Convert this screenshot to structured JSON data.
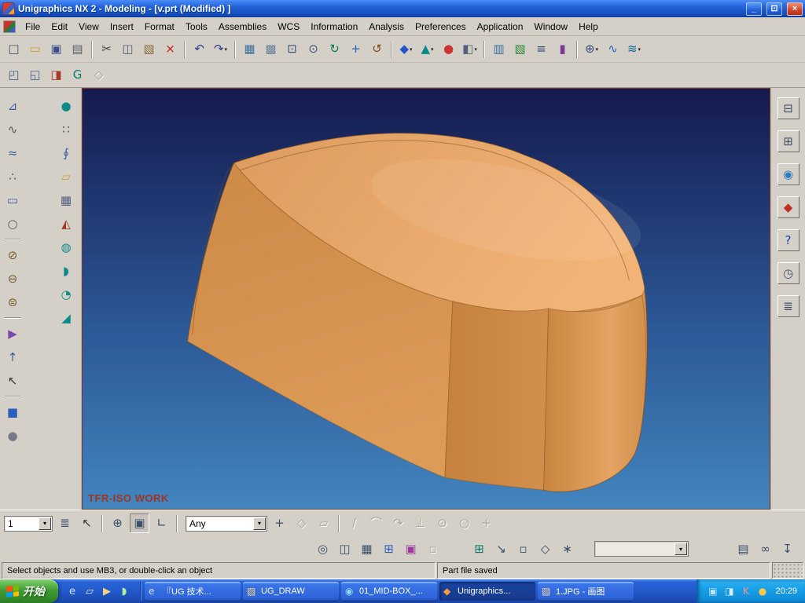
{
  "ui": {
    "dropdown_glyph": "▾"
  },
  "window": {
    "title": "Unigraphics NX 2 - Modeling - [v.prt (Modified) ]",
    "controls": [
      {
        "name": "minimize-button",
        "glyph": "_"
      },
      {
        "name": "restore-button",
        "glyph": "⊡"
      },
      {
        "name": "close-button",
        "glyph": "×"
      }
    ]
  },
  "menu": {
    "items": [
      "File",
      "Edit",
      "View",
      "Insert",
      "Format",
      "Tools",
      "Assemblies",
      "WCS",
      "Information",
      "Analysis",
      "Preferences",
      "Application",
      "Window",
      "Help"
    ]
  },
  "toolbar_main": [
    {
      "name": "new-icon",
      "glyph": "□",
      "color": "#44506a"
    },
    {
      "name": "open-icon",
      "glyph": "▭",
      "color": "#caa12c"
    },
    {
      "name": "save-icon",
      "glyph": "▣",
      "color": "#3a4f8c"
    },
    {
      "name": "print-icon",
      "glyph": "▤",
      "color": "#5a5f66"
    },
    {
      "sep": true
    },
    {
      "name": "cut-icon",
      "glyph": "✂",
      "color": "#444444"
    },
    {
      "name": "copy-icon",
      "glyph": "◫",
      "color": "#55607a"
    },
    {
      "name": "paste-icon",
      "glyph": "▧",
      "color": "#8a6a3a"
    },
    {
      "name": "delete-icon",
      "glyph": "×",
      "color": "#c41a1a"
    },
    {
      "sep": true
    },
    {
      "name": "undo-icon",
      "glyph": "↶",
      "color": "#2a3f8c"
    },
    {
      "name": "redo-icon",
      "glyph": "↷",
      "color": "#2a3f8c",
      "dropdown": true
    },
    {
      "sep": true
    },
    {
      "name": "object-display-icon",
      "glyph": "▦",
      "color": "#3a6f9c"
    },
    {
      "name": "display-mode-icon",
      "glyph": "▩",
      "color": "#6a7f9c"
    },
    {
      "name": "fit-view-icon",
      "glyph": "⊡",
      "color": "#3a4f7c"
    },
    {
      "name": "zoom-icon",
      "glyph": "⊙",
      "color": "#3a4f7c"
    },
    {
      "name": "refresh-icon",
      "glyph": "↻",
      "color": "#0a7a5a"
    },
    {
      "name": "pan-icon",
      "glyph": "+",
      "color": "#2a5fbc"
    },
    {
      "name": "rotate-view-icon",
      "glyph": "↺",
      "color": "#7a4a1a"
    },
    {
      "sep": true
    },
    {
      "name": "shaded-view-icon",
      "glyph": "◆",
      "color": "#2255cc",
      "dropdown": true
    },
    {
      "name": "wireframe-view-icon",
      "glyph": "▲",
      "color": "#0a8a8a",
      "dropdown": true
    },
    {
      "name": "orient-view-icon",
      "glyph": "●",
      "color": "#cc3333"
    },
    {
      "name": "iso-view-icon",
      "glyph": "◧",
      "color": "#55607a",
      "dropdown": true
    },
    {
      "sep": true
    },
    {
      "name": "drafting-icon",
      "glyph": "▥",
      "color": "#3a6f9c"
    },
    {
      "name": "sketch-task-icon",
      "glyph": "▧",
      "color": "#2a8a3a"
    },
    {
      "name": "layer-settings-icon",
      "glyph": "≡",
      "color": "#3a4f6c"
    },
    {
      "name": "expressions-icon",
      "glyph": "▮",
      "color": "#7a3a9c"
    },
    {
      "sep": true
    },
    {
      "name": "snap-point-icon",
      "glyph": "⊕",
      "color": "#3a4f7c",
      "dropdown": true
    },
    {
      "name": "curve-analysis-icon",
      "glyph": "∿",
      "color": "#2a5fbc"
    },
    {
      "name": "visualization-icon",
      "glyph": "≋",
      "color": "#0a6a9a",
      "dropdown": true
    }
  ],
  "toolbar_feature": [
    {
      "name": "pattern-feature-icon",
      "glyph": "◰",
      "color": "#45608a"
    },
    {
      "name": "extrude-feature-icon",
      "glyph": "◱",
      "color": "#45608a"
    },
    {
      "name": "instance-feature-icon",
      "glyph": "◨",
      "color": "#a33a2a"
    },
    {
      "name": "group-feature-icon",
      "glyph": "G",
      "color": "#0a7a6a"
    },
    {
      "name": "update-feature-icon",
      "glyph": "◇",
      "color": "#999999",
      "disabled": true
    }
  ],
  "left_col1": [
    {
      "name": "sketch-icon",
      "glyph": "⊿",
      "color": "#3a5f9c"
    },
    {
      "name": "dashed-curve-icon",
      "glyph": "∿",
      "color": "#555555"
    },
    {
      "name": "spline-icon",
      "glyph": "≈",
      "color": "#3a5f9c"
    },
    {
      "name": "point-icon",
      "glyph": "∴",
      "color": "#555555"
    },
    {
      "name": "rectangle-icon",
      "glyph": "▭",
      "color": "#3a5f9c"
    },
    {
      "name": "ellipse-icon",
      "glyph": "○",
      "color": "#555555"
    },
    {
      "sep": true
    },
    {
      "name": "trim-icon",
      "glyph": "⊘",
      "color": "#7a5a2a"
    },
    {
      "name": "extend-icon",
      "glyph": "⊖",
      "color": "#7a5a2a"
    },
    {
      "name": "offset-icon",
      "glyph": "⊜",
      "color": "#7a5a2a"
    },
    {
      "sep": true
    },
    {
      "name": "project-curve-icon",
      "glyph": "▶",
      "color": "#7a4aaa"
    },
    {
      "name": "raise-icon",
      "glyph": "↑",
      "color": "#3a5f9c"
    },
    {
      "name": "select-arrow-icon",
      "glyph": "↖",
      "color": "#333333"
    },
    {
      "sep": true
    },
    {
      "name": "block-blue-icon",
      "glyph": "■",
      "color": "#2a5fbc"
    },
    {
      "name": "cylinder-gray-icon",
      "glyph": "●",
      "color": "#777788"
    }
  ],
  "left_col2": [
    {
      "name": "sphere-teal-icon",
      "glyph": "●",
      "color": "#0f8a8a"
    },
    {
      "name": "point-set-icon",
      "glyph": "∷",
      "color": "#555555"
    },
    {
      "name": "helix-icon",
      "glyph": "∮",
      "color": "#3a5f9c"
    },
    {
      "name": "sheet-icon",
      "glyph": "▱",
      "color": "#c9a22c"
    },
    {
      "name": "block-grid-icon",
      "glyph": "▦",
      "color": "#55607a"
    },
    {
      "name": "extract-icon",
      "glyph": "◭",
      "color": "#a33a2a"
    },
    {
      "name": "sphere-box-icon",
      "glyph": "◍",
      "color": "#0f8a8a"
    },
    {
      "name": "half-cylinder-icon",
      "glyph": "◗",
      "color": "#0f8a8a"
    },
    {
      "name": "quarter-round-icon",
      "glyph": "◔",
      "color": "#0f8a8a"
    },
    {
      "name": "wedge-icon",
      "glyph": "◢",
      "color": "#0f8a8a"
    }
  ],
  "right_col": [
    {
      "name": "cascade-windows-icon",
      "glyph": "⊟",
      "color": "#44506a"
    },
    {
      "name": "tile-windows-icon",
      "glyph": "⊞",
      "color": "#44506a"
    },
    {
      "name": "web-browser-icon",
      "glyph": "◉",
      "color": "#2a7ac0"
    },
    {
      "name": "training-icon",
      "glyph": "◆",
      "color": "#c03020"
    },
    {
      "name": "help-icon",
      "glyph": "?",
      "color": "#1a3faa"
    },
    {
      "name": "history-clock-icon",
      "glyph": "◷",
      "color": "#44506a"
    },
    {
      "name": "history-list-icon",
      "glyph": "≣",
      "color": "#44506a"
    }
  ],
  "selection_bar": {
    "layer_value": "1",
    "filter_value": "Any",
    "icons_a": [
      {
        "name": "layer-category-icon",
        "glyph": "≣",
        "color": "#3a4f6c"
      },
      {
        "name": "class-selection-icon",
        "glyph": "↖",
        "color": "#333333"
      },
      {
        "sep": true
      },
      {
        "name": "snap-crosshair-icon",
        "glyph": "⊕",
        "color": "#3a4f6c"
      },
      {
        "name": "solid-select-icon",
        "glyph": "▣",
        "color": "#3a4f6c",
        "pressed": true
      },
      {
        "name": "wcs-dynamics-icon",
        "glyph": "∟",
        "color": "#3a4f6c"
      },
      {
        "sep": true
      }
    ],
    "icons_b": [
      {
        "name": "point-constructor-icon",
        "glyph": "+",
        "color": "#3a4f6c"
      },
      {
        "name": "plane-constructor-icon",
        "glyph": "◇",
        "color": "#999999",
        "disabled": true
      },
      {
        "name": "vector-constructor-icon",
        "glyph": "▱",
        "color": "#999999",
        "disabled": true
      },
      {
        "sep": true
      },
      {
        "name": "snap-line-icon",
        "glyph": "∕",
        "color": "#999999",
        "disabled": true
      },
      {
        "name": "snap-arc-icon",
        "glyph": "⌒",
        "color": "#999999",
        "disabled": true
      },
      {
        "name": "snap-tangent-icon",
        "glyph": "↷",
        "color": "#999999",
        "disabled": true
      },
      {
        "name": "snap-perpendicular-icon",
        "glyph": "⊥",
        "color": "#999999",
        "disabled": true
      },
      {
        "name": "snap-center-icon",
        "glyph": "⊙",
        "color": "#999999",
        "disabled": true
      },
      {
        "name": "snap-circle-icon",
        "glyph": "○",
        "color": "#999999",
        "disabled": true
      },
      {
        "name": "snap-plus-icon",
        "glyph": "+",
        "color": "#999999",
        "disabled": true
      }
    ]
  },
  "lower_bar": {
    "icons_a": [
      {
        "name": "find-icon",
        "glyph": "◎",
        "color": "#3a4f6c"
      },
      {
        "name": "inherit-icon",
        "glyph": "◫",
        "color": "#3a4f6c"
      },
      {
        "name": "grid-icon",
        "glyph": "▦",
        "color": "#3a4f6c"
      },
      {
        "name": "info-window-icon",
        "glyph": "⊞",
        "color": "#2a5fbc"
      },
      {
        "name": "capture-icon",
        "glyph": "▣",
        "color": "#9a3a9a"
      },
      {
        "name": "inactive-icon",
        "glyph": "▫",
        "color": "#999999",
        "disabled": true
      }
    ],
    "icons_b": [
      {
        "name": "boolean-add-icon",
        "glyph": "⊞",
        "color": "#0a7a6a"
      },
      {
        "name": "collapse-icon",
        "glyph": "↘",
        "color": "#3a4f6c"
      },
      {
        "name": "small-window-icon",
        "glyph": "▫",
        "color": "#3a4f6c"
      },
      {
        "name": "datum-plane-icon",
        "glyph": "◇",
        "color": "#3a4f6c"
      },
      {
        "name": "adjust-tool-icon",
        "glyph": "∗",
        "color": "#3a4f6c"
      }
    ],
    "combo_value": "",
    "icons_c": [
      {
        "name": "drawing-format-icon",
        "glyph": "▤",
        "color": "#3a4f6c"
      },
      {
        "name": "attachment-icon",
        "glyph": "∞",
        "color": "#3a4f6c"
      },
      {
        "name": "more-tools-icon",
        "glyph": "↧",
        "color": "#3a4f6c"
      }
    ]
  },
  "viewport": {
    "label": "TFR-ISO WORK",
    "colors": {
      "bg_top": "#141a4e",
      "bg_mid": "#2b5694",
      "bg_bottom": "#4285bf",
      "base": "#d6914f",
      "top_dark": "#dd9c5e",
      "top_light": "#f2b377",
      "front_dark": "#cd8946",
      "front_light": "#dd9b58",
      "mid_dark": "#c5813d",
      "mid_light": "#d38f4d",
      "right_dark": "#c98540",
      "right_light": "#e5a463",
      "right_edge": "#d28f4c"
    }
  },
  "status": {
    "prompt": "Select objects and use MB3, or double-click an object",
    "message": "Part file saved"
  },
  "taskbar": {
    "start": "开始",
    "quick_launch": [
      {
        "name": "quicklaunch-browser-icon",
        "glyph": "e",
        "color": "#cfe6ff"
      },
      {
        "name": "quicklaunch-desktop-icon",
        "glyph": "▱",
        "color": "#d8ecff"
      },
      {
        "name": "quicklaunch-media-icon",
        "glyph": "▶",
        "color": "#ffd27a"
      },
      {
        "name": "quicklaunch-messenger-icon",
        "glyph": "◗",
        "color": "#aef0a0"
      }
    ],
    "tasks": [
      {
        "id": "ug-doc",
        "icon": "browser-icon",
        "glyph": "e",
        "color": "#cfe6ff",
        "label": "『UG 技术..."
      },
      {
        "id": "ug-draw",
        "icon": "folder-icon",
        "glyph": "▨",
        "color": "#f5d87a",
        "label": "UG_DRAW"
      },
      {
        "id": "mid-box",
        "icon": "app-icon",
        "glyph": "◉",
        "color": "#8fd8ff",
        "label": "01_MID-BOX_..."
      },
      {
        "id": "unigraphics",
        "icon": "nx-icon",
        "glyph": "◆",
        "color": "#ff9a3a",
        "label": "Unigraphics...",
        "active": true
      },
      {
        "id": "paint",
        "icon": "paint-icon",
        "glyph": "▧",
        "color": "#ffd0a0",
        "label": "1.JPG - 画图"
      }
    ],
    "tray_icons": [
      {
        "name": "tray-app-icon",
        "glyph": "▣",
        "color": "#bfe2ff"
      },
      {
        "name": "tray-ime-icon",
        "glyph": "◨",
        "color": "#d8ecff"
      },
      {
        "name": "tray-antivirus-icon",
        "glyph": "K",
        "color": "#ff9090"
      },
      {
        "name": "tray-alert-icon",
        "glyph": "●",
        "color": "#ffc848"
      }
    ],
    "clock": "20:29"
  }
}
